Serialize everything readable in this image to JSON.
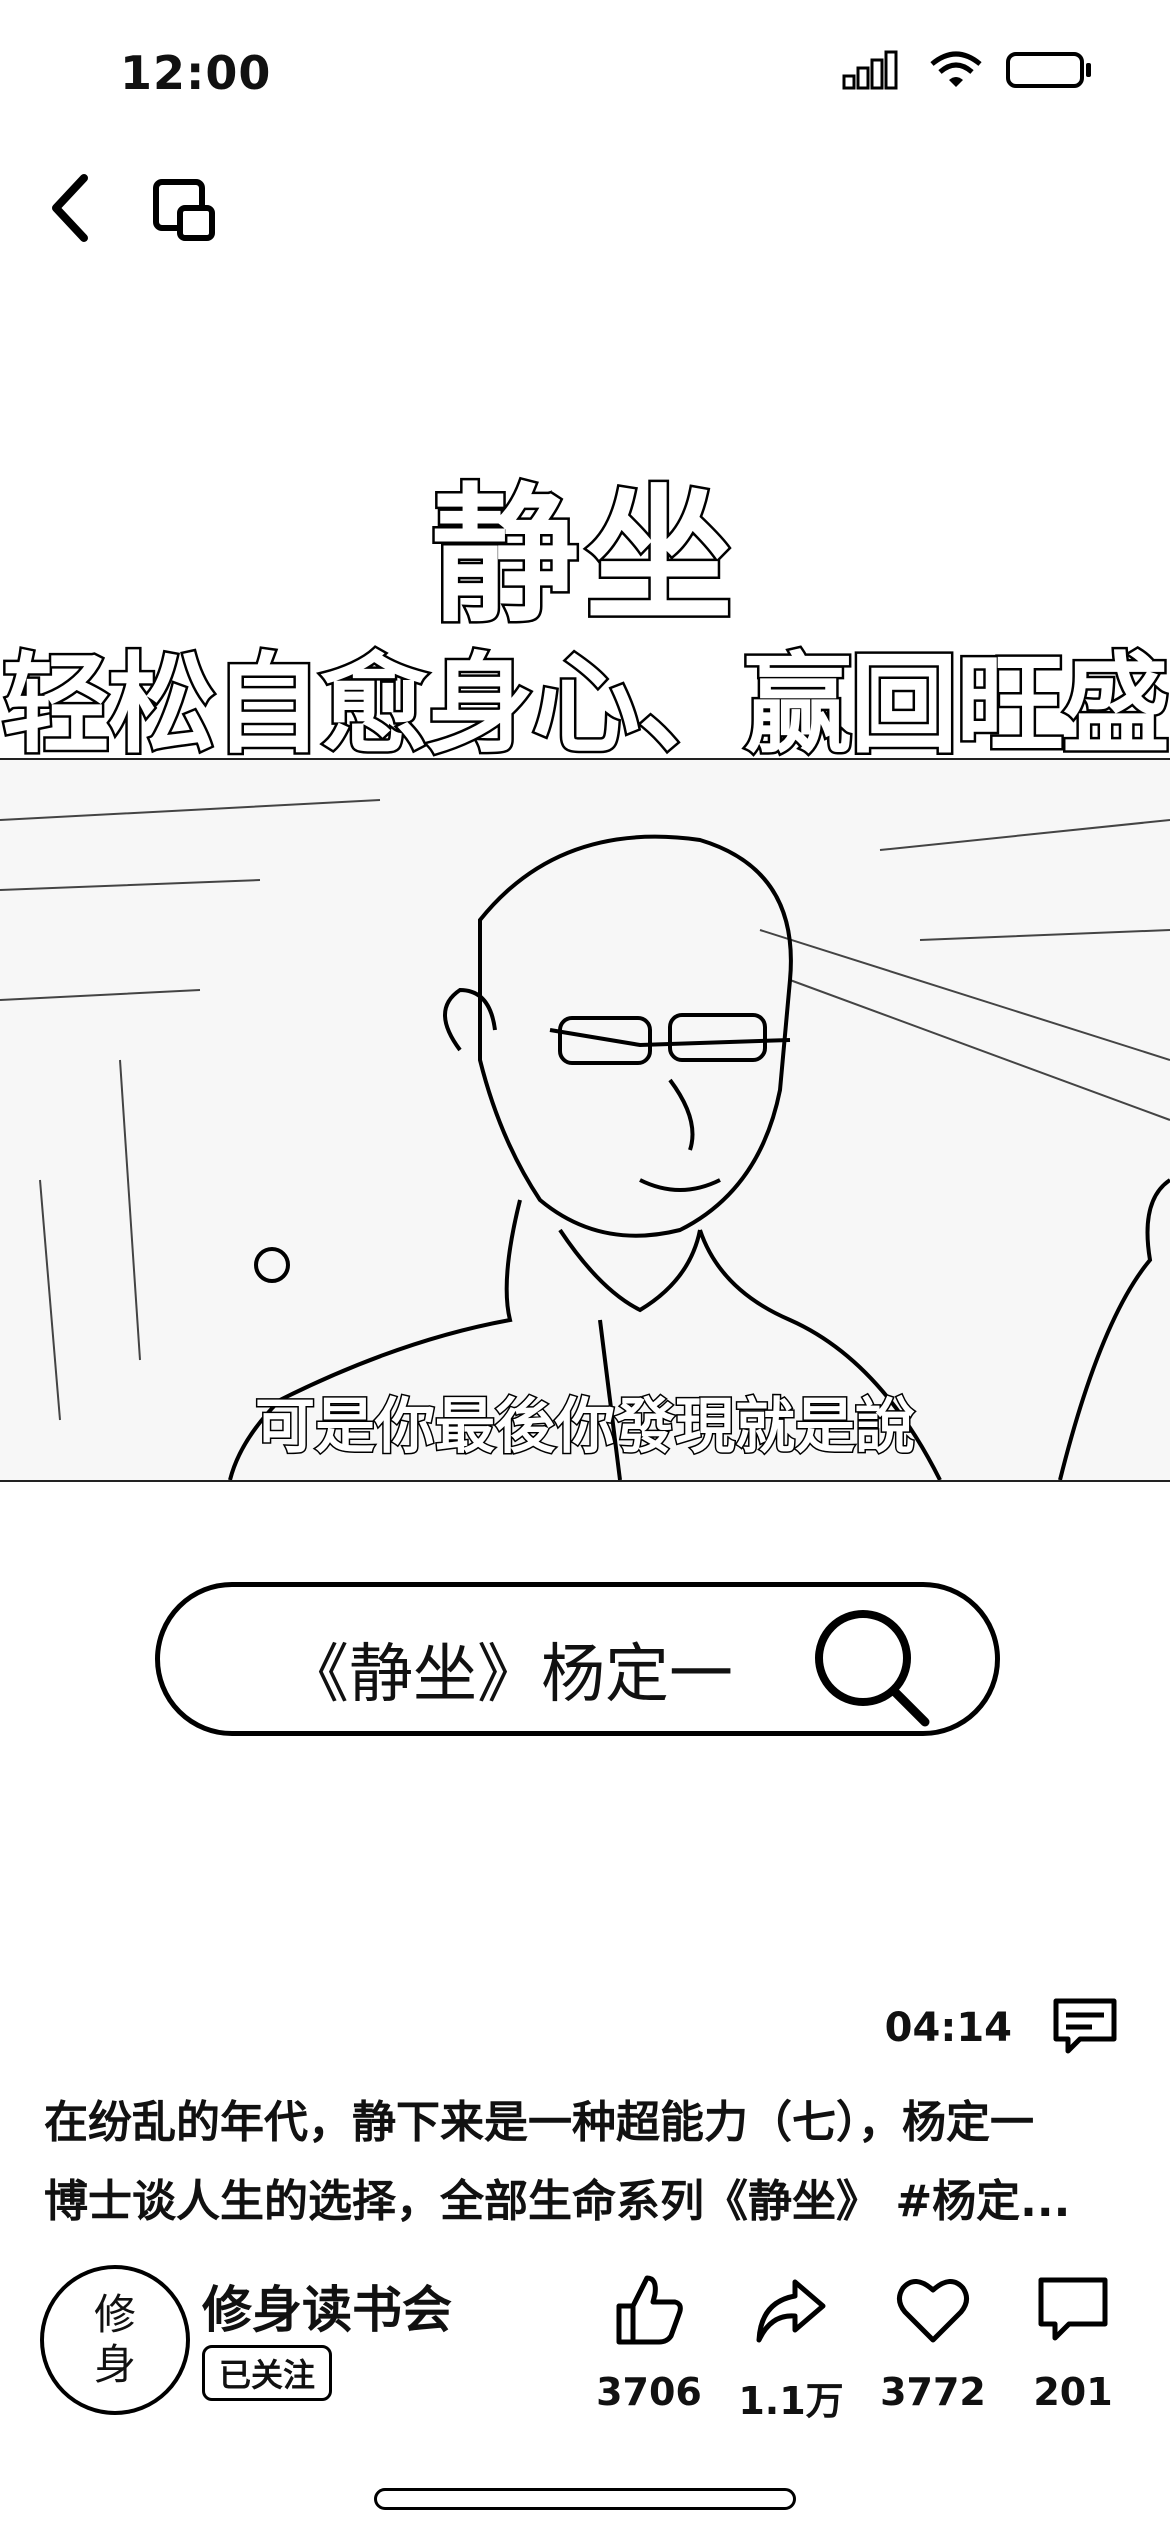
{
  "status_bar": {
    "time": "12:00"
  },
  "video": {
    "title_main": "静坐",
    "title_sub": "轻松自愈身心、赢回旺盛心力",
    "subtitle_caption": "可是你最後你發現就是說",
    "search_text": "《静坐》杨定一",
    "duration": "04:14"
  },
  "description": {
    "line1": "在纷乱的年代，静下来是一种超能力（七），杨定一",
    "line2": "博士谈人生的选择，全部生命系列《静坐》 #杨定..."
  },
  "account": {
    "avatar_line1": "修",
    "avatar_line2": "身",
    "name": "修身读书会",
    "follow_status": "已关注"
  },
  "actions": {
    "like_count": "3706",
    "share_count": "1.1万",
    "favorite_count": "3772",
    "comment_count": "201"
  }
}
